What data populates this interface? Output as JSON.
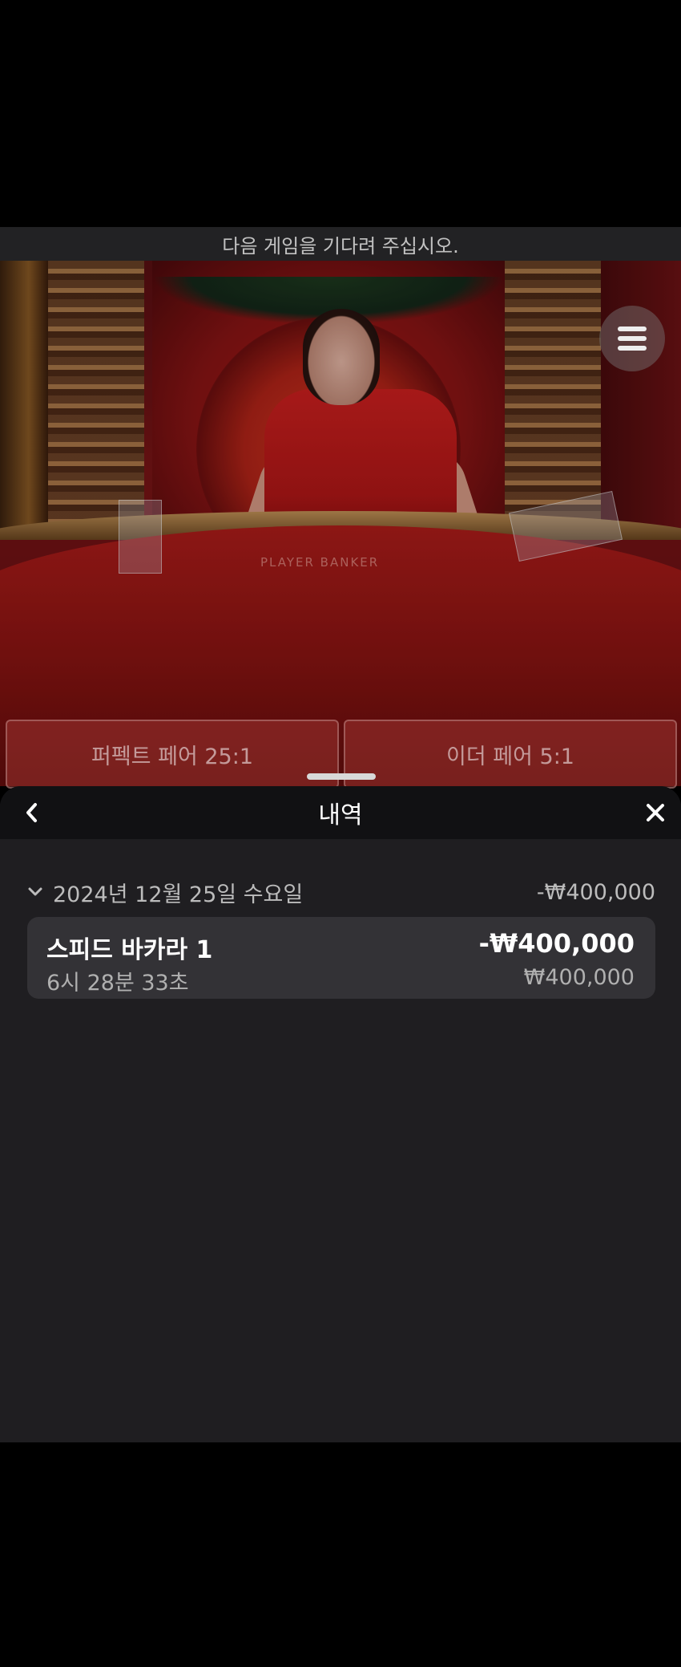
{
  "status_banner": "다음 게임을 기다려 주십시오.",
  "video": {
    "table_label": "PLAYER BANKER"
  },
  "bet_spots": [
    {
      "label": "퍼펙트 페어 25:1"
    },
    {
      "label": "이더 페어 5:1"
    }
  ],
  "history": {
    "title": "내역",
    "back_icon": "chevron-left-icon",
    "close_icon": "close-icon",
    "groups": [
      {
        "date": "2024년 12월 25일 수요일",
        "total": "-₩400,000",
        "items": [
          {
            "game": "스피드 바카라 1",
            "time": "6시 28분 33초",
            "result": "-₩400,000",
            "bet": "₩400,000"
          }
        ]
      }
    ]
  },
  "colors": {
    "sheet_bg": "#1f1e21",
    "header_bg": "#111113",
    "card_bg": "#333236"
  }
}
